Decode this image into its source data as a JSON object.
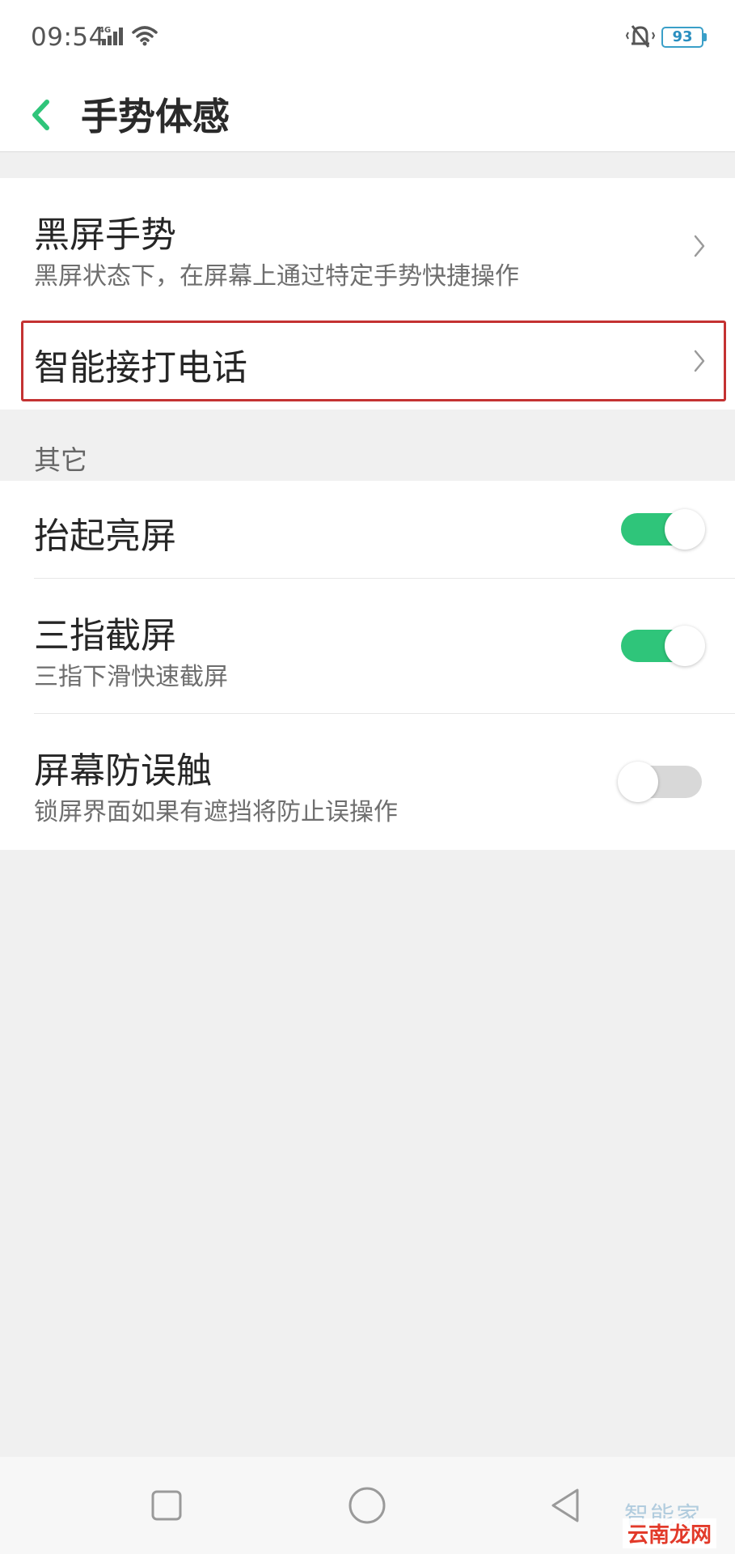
{
  "status_bar": {
    "time": "09:54",
    "signal_label": "4G",
    "battery": "93",
    "icons": [
      "signal-icon",
      "wifi-icon",
      "bell-mute-icon",
      "battery-icon"
    ]
  },
  "header": {
    "title": "手势体感",
    "back_icon": "chevron-left-icon"
  },
  "gestures": {
    "items": [
      {
        "title": "黑屏手势",
        "subtitle": "黑屏状态下，在屏幕上通过特定手势快捷操作"
      },
      {
        "title": "智能接打电话"
      }
    ]
  },
  "other": {
    "section_label": "其它",
    "items": [
      {
        "title": "抬起亮屏",
        "enabled": true
      },
      {
        "title": "三指截屏",
        "subtitle": "三指下滑快速截屏",
        "enabled": true
      },
      {
        "title": "屏幕防误触",
        "subtitle": "锁屏界面如果有遮挡将防止误操作",
        "enabled": false
      }
    ]
  },
  "nav_bar": {
    "icons": [
      "square-recents-icon",
      "circle-home-icon",
      "triangle-back-icon"
    ]
  },
  "watermark": {
    "line1": "智能家",
    "line2": "云南龙网"
  },
  "colors": {
    "accent": "#2fc57a",
    "toggle_off": "#d8d8d8",
    "highlight_border": "#c43232",
    "battery": "#3a9fc8"
  }
}
